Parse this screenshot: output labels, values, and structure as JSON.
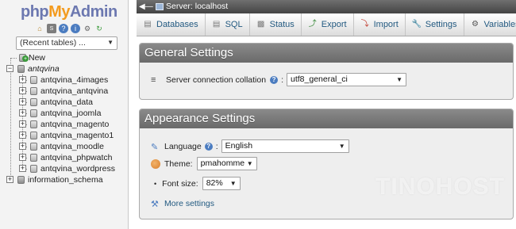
{
  "nav": {
    "logo": {
      "php": "php",
      "my": "My",
      "admin": "Admin"
    },
    "icons": [
      "home-icon",
      "sql-icon",
      "help-icon",
      "docs-icon",
      "settings-icon",
      "reload-icon"
    ],
    "recent_tables": "(Recent tables) ...",
    "tree": {
      "new_label": "New",
      "current_db": "antqvina",
      "tables": [
        "antqvina_4images",
        "antqvina_antqvina",
        "antqvina_data",
        "antqvina_joomla",
        "antqvina_magento",
        "antqvina_magento1",
        "antqvina_moodle",
        "antqvina_phpwatch",
        "antqvina_wordpress"
      ],
      "other_db": "information_schema"
    }
  },
  "server_bar": {
    "label": "Server: localhost"
  },
  "tabs": [
    {
      "label": "Databases",
      "icon": "databases-icon"
    },
    {
      "label": "SQL",
      "icon": "sql-icon"
    },
    {
      "label": "Status",
      "icon": "status-icon"
    },
    {
      "label": "Export",
      "icon": "export-icon"
    },
    {
      "label": "Import",
      "icon": "import-icon"
    },
    {
      "label": "Settings",
      "icon": "settings-icon"
    },
    {
      "label": "Variables",
      "icon": "variables-icon"
    }
  ],
  "general": {
    "title": "General Settings",
    "collation_label": "Server connection collation",
    "collation_value": "utf8_general_ci"
  },
  "appearance": {
    "title": "Appearance Settings",
    "language_label": "Language",
    "language_value": "English",
    "theme_label": "Theme:",
    "theme_value": "pmahomme",
    "fontsize_label": "Font size:",
    "fontsize_value": "82%",
    "more_settings": "More settings"
  },
  "watermark": "TINOHOST",
  "colors": {
    "link": "#235a81",
    "group_header": "#7a7a7a",
    "logo_blue": "#6c78b0",
    "logo_orange": "#f39b1f"
  }
}
